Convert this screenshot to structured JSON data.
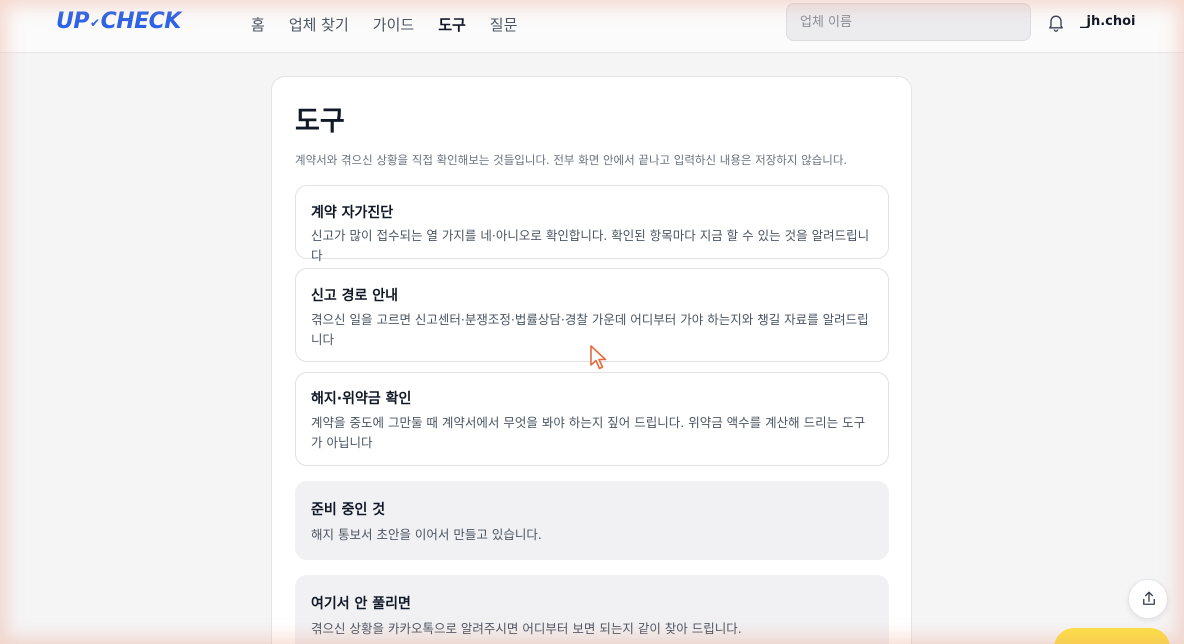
{
  "header": {
    "logo_left": "UP",
    "logo_mid": "✔",
    "logo_right": "CHECK",
    "nav": [
      {
        "label": "홈"
      },
      {
        "label": "업체 찾기"
      },
      {
        "label": "가이드"
      },
      {
        "label": "도구",
        "active": true
      },
      {
        "label": "질문"
      }
    ],
    "search_placeholder": "업체 이름",
    "bell_icon": "bell-icon",
    "username": "_jh.choi"
  },
  "page": {
    "title": "도구",
    "subtitle": "계약서와 겪으신 상황을 직접 확인해보는 것들입니다. 전부 화면 안에서 끝나고 입력하신 내용은 저장하지 않습니다."
  },
  "tools": [
    {
      "title": "계약 자가진단",
      "desc": "신고가 많이 접수되는 열 가지를 네·아니오로 확인합니다. 확인된 항목마다 지금 할 수 있는 것을 알려드립니다"
    },
    {
      "title": "신고 경로 안내",
      "desc": "겪으신 일을 고르면 신고센터·분쟁조정·법률상담·경찰 가운데 어디부터 가야 하는지와 챙길 자료를 알려드립니다"
    },
    {
      "title": "해지·위약금 확인",
      "desc": "계약을 중도에 그만둘 때 계약서에서 무엇을 봐야 하는지 짚어 드립니다. 위약금 액수를 계산해 드리는 도구가 아닙니다"
    },
    {
      "title": "준비 중인 것",
      "desc": "해지 통보서 초안을 이어서 만들고 있습니다."
    },
    {
      "title": "여기서 안 풀리면",
      "desc": "겪으신 상황을 카카오톡으로 알려주시면 어디부터 보면 되는지 같이 찾아 드립니다."
    }
  ],
  "colors": {
    "brand": "#2e63e6",
    "kakao": "#fde047"
  },
  "icons": {
    "share": "share-icon",
    "cursor": "mouse-cursor-icon"
  }
}
